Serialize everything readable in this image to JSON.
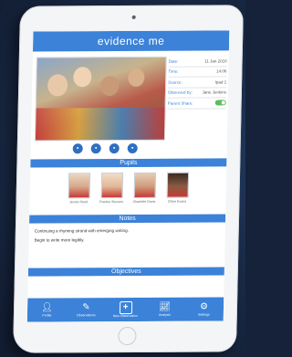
{
  "app": {
    "title": "evidence me"
  },
  "info": [
    {
      "label": "Date:",
      "value": "11 Jan 2018"
    },
    {
      "label": "Time:",
      "value": "14:06"
    },
    {
      "label": "Source:",
      "value": "Ipad 1"
    },
    {
      "label": "Observed by:",
      "value": "Jane Jenkins"
    },
    {
      "label": "Parent Share:",
      "value": ""
    }
  ],
  "sections": {
    "pupils": "Pupils",
    "notes": "Notes",
    "objectives": "Objectives"
  },
  "pupils": [
    {
      "name": "Jennie Reed"
    },
    {
      "name": "Frankie Stevens"
    },
    {
      "name": "Charlotte Davis"
    },
    {
      "name": "Chloe Evans"
    }
  ],
  "notes": [
    "Continuing a rhyming strand with emerging writing.",
    "Begin to write more legibly."
  ],
  "nav": [
    {
      "label": "Profile",
      "icon": "person-icon"
    },
    {
      "label": "Observations",
      "icon": "edit-icon"
    },
    {
      "label": "New Observation",
      "icon": "plus-icon"
    },
    {
      "label": "Analysis",
      "icon": "chart-icon"
    },
    {
      "label": "Settings",
      "icon": "gear-icon"
    }
  ],
  "colors": {
    "primary": "#3b82d8",
    "toggle_on": "#5bbd5b"
  }
}
